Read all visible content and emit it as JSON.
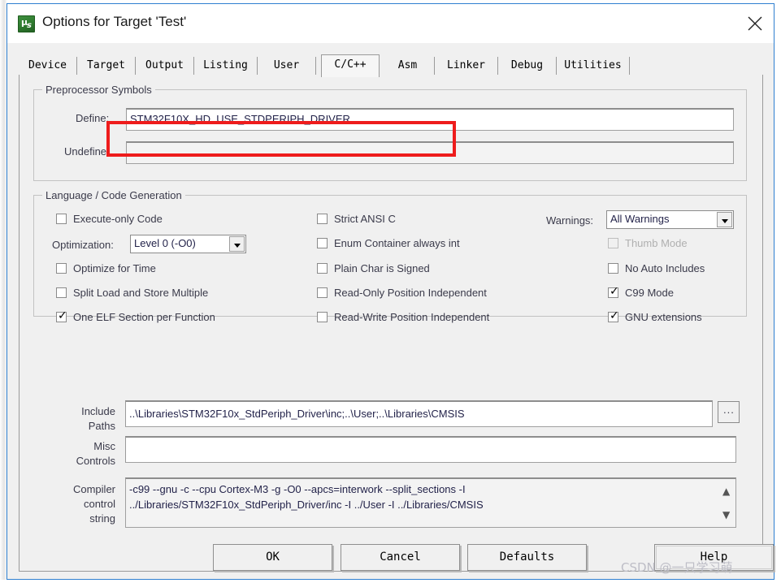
{
  "window": {
    "title": "Options for Target 'Test'",
    "icon": "keil-uvision-icon",
    "close_icon": "close-icon",
    "accent_color": "#2e7fd0",
    "highlight_color": "#ee1c1c"
  },
  "tabs": [
    {
      "label": "Device",
      "selected": false
    },
    {
      "label": "Target",
      "selected": false
    },
    {
      "label": "Output",
      "selected": false
    },
    {
      "label": "Listing",
      "selected": false
    },
    {
      "label": "User",
      "selected": false
    },
    {
      "label": "C/C++",
      "selected": true
    },
    {
      "label": "Asm",
      "selected": false
    },
    {
      "label": "Linker",
      "selected": false
    },
    {
      "label": "Debug",
      "selected": false
    },
    {
      "label": "Utilities",
      "selected": false
    }
  ],
  "preprocessor": {
    "title": "Preprocessor Symbols",
    "define_label": "Define:",
    "define_value": "STM32F10X_HD, USE_STDPERIPH_DRIVER",
    "undefine_label": "Undefine:",
    "undefine_value": ""
  },
  "language": {
    "title": "Language / Code Generation",
    "col1": [
      {
        "label": "Execute-only Code",
        "checked": false,
        "disabled": false
      },
      {
        "label": "Optimize for Time",
        "checked": false,
        "disabled": false
      },
      {
        "label": "Split Load and Store Multiple",
        "checked": false,
        "disabled": false
      },
      {
        "label": "One ELF Section per Function",
        "checked": true,
        "disabled": false
      }
    ],
    "optimization_label": "Optimization:",
    "optimization_value": "Level 0 (-O0)",
    "col2": [
      {
        "label": "Strict ANSI C",
        "checked": false,
        "disabled": false
      },
      {
        "label": "Enum Container always int",
        "checked": false,
        "disabled": false
      },
      {
        "label": "Plain Char is Signed",
        "checked": false,
        "disabled": false
      },
      {
        "label": "Read-Only Position Independent",
        "checked": false,
        "disabled": false
      },
      {
        "label": "Read-Write Position Independent",
        "checked": false,
        "disabled": false
      }
    ],
    "warnings_label": "Warnings:",
    "warnings_value": "All Warnings",
    "col3": [
      {
        "label": "Thumb Mode",
        "checked": false,
        "disabled": true
      },
      {
        "label": "No Auto Includes",
        "checked": false,
        "disabled": false
      },
      {
        "label": "C99 Mode",
        "checked": true,
        "disabled": false
      },
      {
        "label": "GNU extensions",
        "checked": true,
        "disabled": false
      }
    ]
  },
  "paths": {
    "include_label_line1": "Include",
    "include_label_line2": "Paths",
    "include_value": "..\\Libraries\\STM32F10x_StdPeriph_Driver\\inc;..\\User;..\\Libraries\\CMSIS",
    "browse_label": "...",
    "misc_label_line1": "Misc",
    "misc_label_line2": "Controls",
    "misc_value": "",
    "compiler_label_line1": "Compiler",
    "compiler_label_line2": "control",
    "compiler_label_line3": "string",
    "compiler_value_line1": "-c99 --gnu -c --cpu Cortex-M3 -g -O0 --apcs=interwork --split_sections -I",
    "compiler_value_line2": "../Libraries/STM32F10x_StdPeriph_Driver/inc -I ../User -I ../Libraries/CMSIS",
    "scroll_up_icon": "chevron-up-icon",
    "scroll_down_icon": "chevron-down-icon"
  },
  "buttons": {
    "ok": "OK",
    "cancel": "Cancel",
    "defaults": "Defaults",
    "help": "Help"
  },
  "watermark": "CSDN @一只学习萌"
}
